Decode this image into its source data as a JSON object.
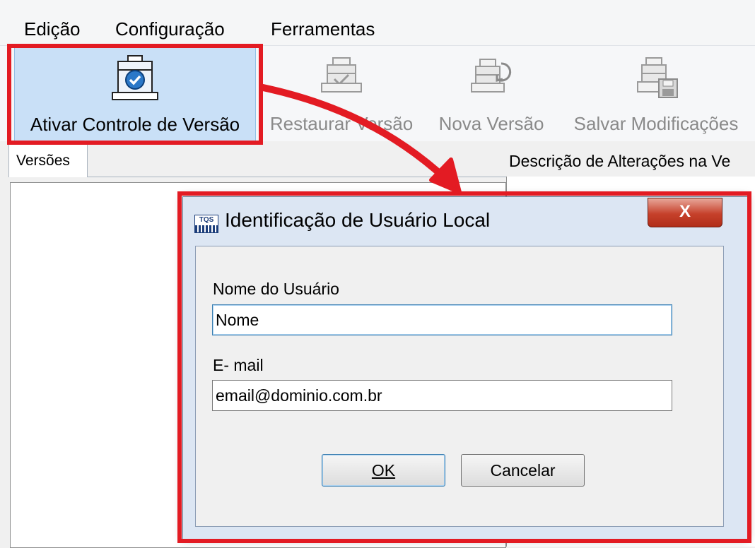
{
  "menu": {
    "items": [
      "Edição",
      "Configuração",
      "Ferramentas"
    ]
  },
  "ribbon": {
    "buttons": [
      {
        "label": "Ativar Controle de Versão",
        "icon": "database-check-icon",
        "state": "active"
      },
      {
        "label": "Restaurar Versão",
        "icon": "database-restore-icon",
        "state": "disabled"
      },
      {
        "label": "Nova Versão",
        "icon": "database-new-version-icon",
        "state": "disabled"
      },
      {
        "label": "Salvar Modificações",
        "icon": "database-save-icon",
        "state": "disabled"
      }
    ]
  },
  "tabs": {
    "versions": "Versões"
  },
  "panel": {
    "description_label": "Descrição de Alterações na Ve"
  },
  "dialog": {
    "logo_text": "TQS",
    "title": "Identificação de Usuário Local",
    "close_label": "X",
    "user_name_label": "Nome do Usuário",
    "user_name_value": "Nome",
    "email_label": "E- mail",
    "email_value": "email@dominio.com.br",
    "ok_label": "OK",
    "cancel_label": "Cancelar"
  },
  "colors": {
    "annotation": "#e31b23",
    "ribbon_active": "#c9e0f7",
    "close_button": "#c6412b",
    "dialog_frame": "#dce6f3"
  }
}
